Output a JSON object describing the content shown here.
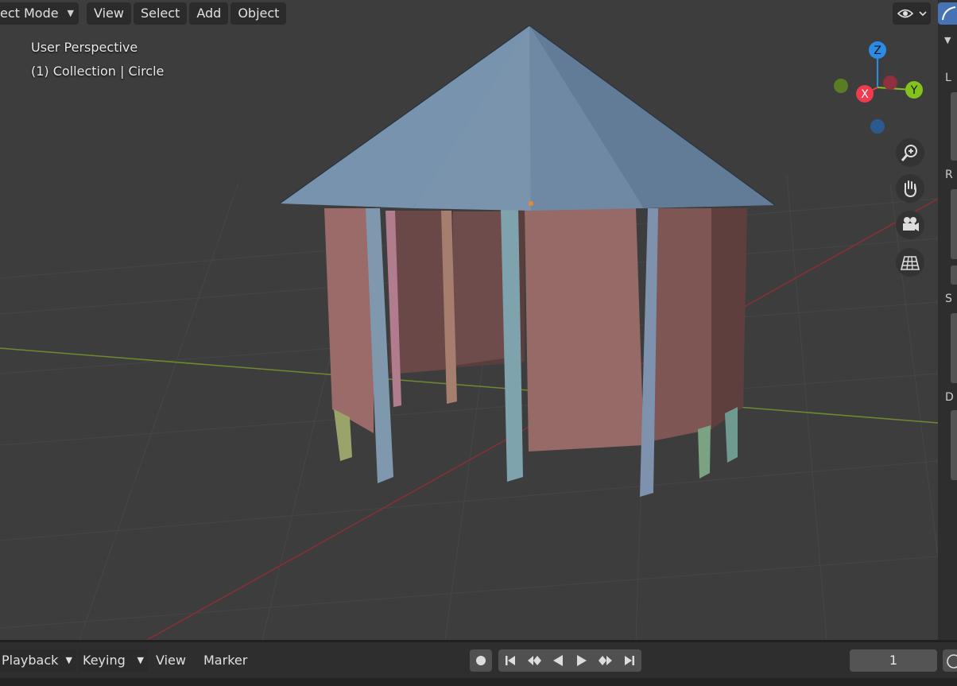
{
  "header": {
    "mode_label": "ect Mode",
    "menus": [
      "View",
      "Select",
      "Add",
      "Object"
    ]
  },
  "viewport": {
    "perspective_label": "User Perspective",
    "collection_label": "(1) Collection | Circle"
  },
  "gizmo": {
    "z_label": "Z",
    "x_label": "X",
    "y_label": "Y",
    "colors": {
      "x": "#f03a4d",
      "y": "#83c21b",
      "z": "#2b8ce6"
    }
  },
  "nav_icons": [
    "zoom-icon",
    "hand-pan-icon",
    "camera-icon",
    "grid-view-icon"
  ],
  "right_panel": {
    "fragments": [
      "L",
      "R",
      "S",
      "D"
    ]
  },
  "timeline": {
    "playback_label": "Playback",
    "keying_label": "Keying",
    "view_label": "View",
    "marker_label": "Marker",
    "current_frame": "1"
  }
}
